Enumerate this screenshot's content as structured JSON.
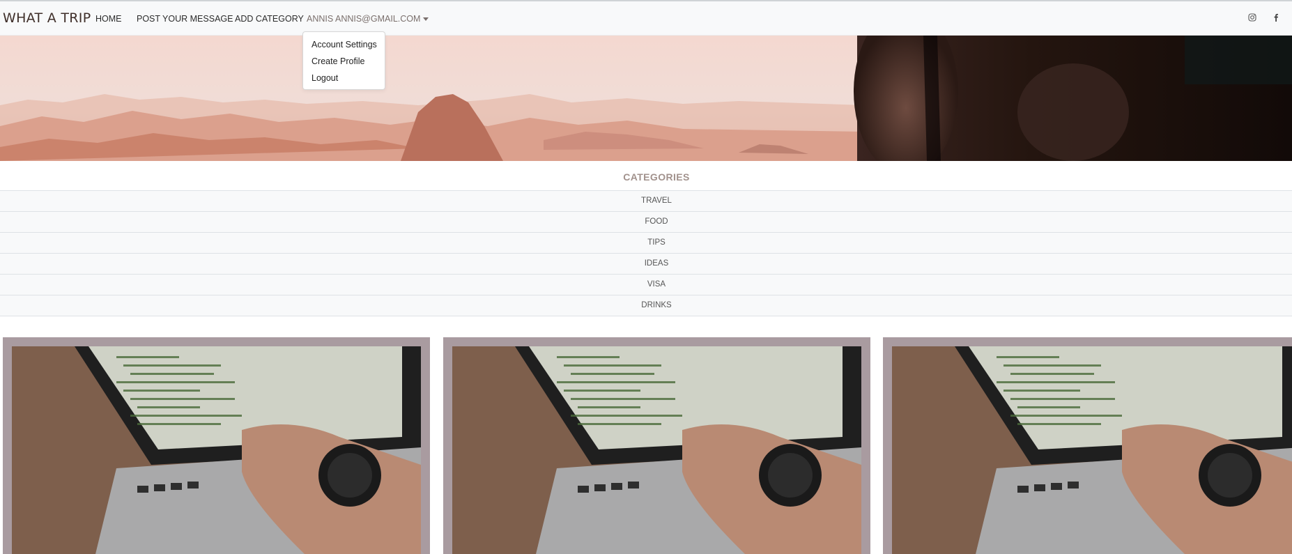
{
  "navbar": {
    "brand": "WHAT A TRIP",
    "links": [
      {
        "label": "HOME"
      },
      {
        "label": "POST YOUR MESSAGE"
      },
      {
        "label": "ADD CATEGORY"
      }
    ],
    "user_menu_label": "ANNIS ANNIS@GMAIL.COM",
    "social_icons": [
      "instagram-icon",
      "facebook-icon"
    ]
  },
  "user_dropdown": {
    "items": [
      {
        "label": "Account Settings"
      },
      {
        "label": "Create Profile"
      },
      {
        "label": "Logout"
      }
    ]
  },
  "categories": {
    "title": "CATEGORIES",
    "items": [
      "TRAVEL",
      "FOOD",
      "TIPS",
      "IDEAS",
      "VISA",
      "DRINKS"
    ]
  },
  "cards": [
    {
      "image": "laptop-code-photo"
    },
    {
      "image": "laptop-code-photo"
    },
    {
      "image": "laptop-code-photo"
    }
  ],
  "colors": {
    "navbar_bg": "#f8f9fa",
    "card_frame": "#a99ba0",
    "category_title": "#a1918c",
    "hero_tint": "#e9c4b7"
  }
}
